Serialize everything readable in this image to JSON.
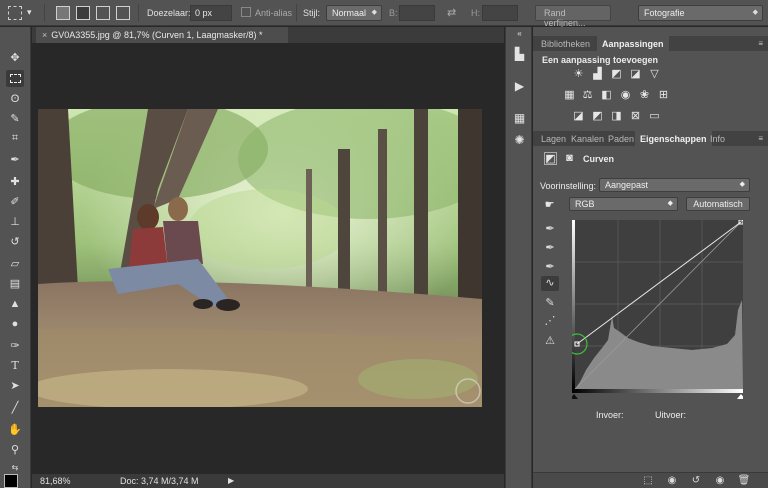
{
  "options_bar": {
    "feather_label": "Doezelaar:",
    "feather_value": "0 px",
    "antialias_label": "Anti-alias",
    "style_label": "Stijl:",
    "style_value": "Normaal",
    "width_label": "B:",
    "height_label": "H:",
    "refine_edge_button": "Rand verfijnen...",
    "workspace_value": "Fotografie"
  },
  "document": {
    "tab_title": "GV0A3355.jpg @ 81,7% (Curven 1, Laagmasker/8) *",
    "zoom": "81,68%",
    "doc_size": "Doc: 3,74 M/3,74 M"
  },
  "panels": {
    "top_tabs": [
      "Bibliotheken",
      "Aanpassingen"
    ],
    "adjustments_heading": "Een aanpassing toevoegen",
    "mid_tabs": [
      "Lagen",
      "Kanalen",
      "Paden",
      "Eigenschappen",
      "Info"
    ],
    "properties_title": "Curven",
    "preset_label": "Voorinstelling:",
    "preset_value": "Aangepast",
    "channel_value": "RGB",
    "auto_button": "Automatisch",
    "input_label": "Invoer:",
    "output_label": "Uitvoer:"
  },
  "colors": {
    "ui_bg": "#535353",
    "canvas_bg": "#282828",
    "curve_line": "#e8e8e8",
    "histogram": "#8a8a8a",
    "highlight_circle": "#3fbf3f"
  },
  "toolbar_icons": [
    "move-icon",
    "marquee-icon",
    "lasso-icon",
    "quick-select-icon",
    "crop-icon",
    "eyedropper-icon",
    "healing-icon",
    "brush-icon",
    "stamp-icon",
    "history-brush-icon",
    "eraser-icon",
    "gradient-icon",
    "blur-icon",
    "dodge-icon",
    "pen-icon",
    "type-icon",
    "path-select-icon",
    "rectangle-icon",
    "hand-icon",
    "zoom-icon"
  ]
}
